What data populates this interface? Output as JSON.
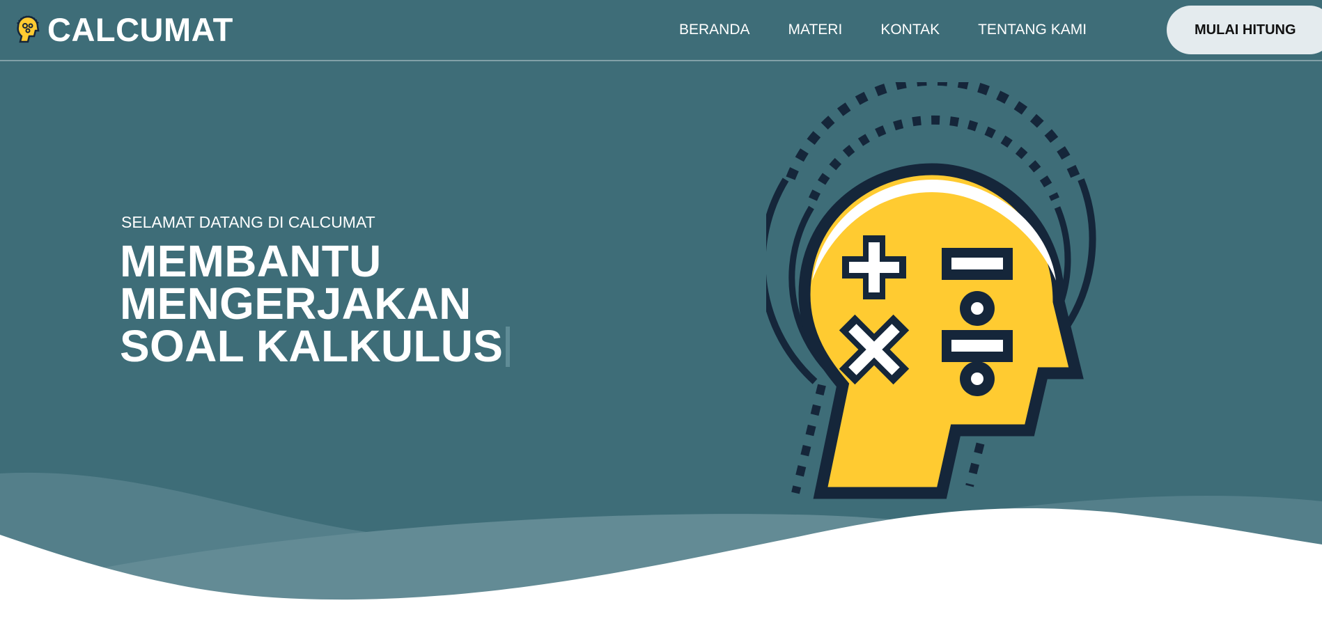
{
  "brand": {
    "name": "CALCUMAT",
    "logo_icon": "head-math-icon"
  },
  "nav": {
    "links": [
      {
        "label": "BERANDA"
      },
      {
        "label": "MATERI"
      },
      {
        "label": "KONTAK"
      },
      {
        "label": "TENTANG KAMI"
      }
    ],
    "cta_label": "MULAI HITUNG"
  },
  "hero": {
    "subtitle": "SELAMAT DATANG DI CALCUMAT",
    "title": "MEMBANTU MENGERJAKAN SOAL KALKULUS",
    "illustration_icon": "head-math-symbols-icon"
  },
  "colors": {
    "hero_background": "#3e6d78",
    "cta_background": "#e4ebee",
    "head_fill": "#ffcb31",
    "outline": "#15263a",
    "wave_light": "#ffffff"
  }
}
